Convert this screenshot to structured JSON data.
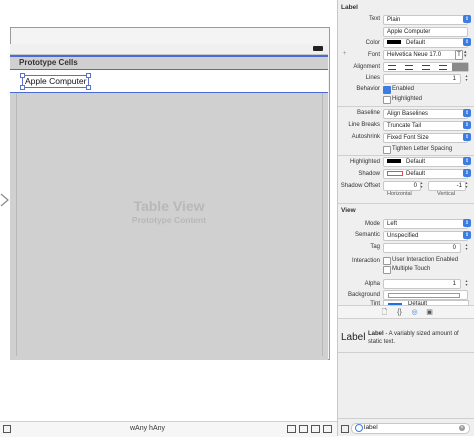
{
  "canvas": {
    "dock_icons": [
      {
        "name": "view-controller-icon",
        "color": "#f2b933"
      },
      {
        "name": "first-responder-icon",
        "color": "#e8652c"
      },
      {
        "name": "exit-icon",
        "color": "#e05a3a"
      }
    ],
    "prototype_cells_label": "Prototype Cells",
    "cell_label_text": "Apple Computer",
    "table_view_title": "Table View",
    "table_view_subtitle": "Prototype Content"
  },
  "bottom_bar": {
    "size_class": "wAny hAny"
  },
  "inspector": {
    "label_section": {
      "title": "Label",
      "text_label": "Text",
      "text_value": "Plain",
      "content_value": "Apple Computer",
      "color_label": "Color",
      "color_value": "Default",
      "font_label": "Font",
      "font_value": "Helvetica Neue 17.0",
      "alignment_label": "Alignment",
      "lines_label": "Lines",
      "lines_value": "1",
      "behavior_label": "Behavior",
      "enabled_label": "Enabled",
      "highlighted_label": "Highlighted",
      "baseline_label": "Baseline",
      "baseline_value": "Align Baselines",
      "line_breaks_label": "Line Breaks",
      "line_breaks_value": "Truncate Tail",
      "autoshrink_label": "Autoshrink",
      "autoshrink_value": "Fixed Font Size",
      "tighten_label": "Tighten Letter Spacing",
      "highlighted_color_label": "Highlighted",
      "highlighted_color_value": "Default",
      "shadow_label": "Shadow",
      "shadow_value": "Default",
      "shadow_offset_label": "Shadow Offset",
      "shadow_h_value": "0",
      "shadow_v_value": "-1",
      "horizontal_label": "Horizontal",
      "vertical_label": "Vertical"
    },
    "view_section": {
      "title": "View",
      "mode_label": "Mode",
      "mode_value": "Left",
      "semantic_label": "Semantic",
      "semantic_value": "Unspecified",
      "tag_label": "Tag",
      "tag_value": "0",
      "interaction_label": "Interaction",
      "user_interaction_label": "User Interaction Enabled",
      "multiple_touch_label": "Multiple Touch",
      "alpha_label": "Alpha",
      "alpha_value": "1",
      "background_label": "Background",
      "tint_label": "Tint",
      "tint_value": "Default"
    },
    "library": {
      "item_big": "Label",
      "item_name": "Label",
      "item_desc": " - A variably sized amount of static text.",
      "filter_value": "label"
    }
  },
  "colors": {
    "selection_blue": "#4a6bd6",
    "button_blue": "#3b7de1",
    "tint_blue": "#1f6fe0"
  }
}
